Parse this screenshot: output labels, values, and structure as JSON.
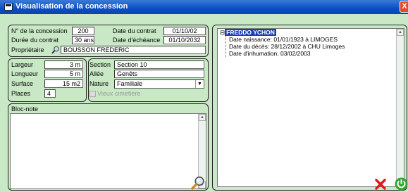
{
  "window": {
    "title": "Visualisation de la concession",
    "close_symbol": "X"
  },
  "concession": {
    "numero_label": "N° de la concession",
    "numero_value": "200",
    "duree_label": "Durée du contrat",
    "duree_value": "30 ans",
    "date_contrat_label": "Date du contrat",
    "date_contrat_value": "01/10/02",
    "date_echeance_label": "Date d'échéance",
    "date_echeance_value": "01/10/2032",
    "proprietaire_label": "Propriétaire",
    "proprietaire_value": "BOUSSON FREDERIC"
  },
  "dimensions": {
    "largeur_label": "Largeur",
    "largeur_value": "3 m",
    "longueur_label": "Longueur",
    "longueur_value": "5 m",
    "surface_label": "Surface",
    "surface_value": "15 m2",
    "places_label": "Places",
    "places_value": "4"
  },
  "location": {
    "section_label": "Section",
    "section_value": "Section 10",
    "allee_label": "Allée",
    "allee_value": "Genêts",
    "nature_label": "Nature",
    "nature_value": "Familiale",
    "vieux_cimetiere_label": "Vieux cimetière"
  },
  "bloc_note": {
    "label": "Bloc-note",
    "text": ""
  },
  "tree": {
    "expander": "⊟",
    "root": "FREDDO YCHON",
    "children": [
      "Date naissance: 01/01/1923 à LIMOGES",
      "Date du décès: 28/12/2002 à CHU Limoges",
      "Date d'inhumation: 03/02/2003"
    ]
  },
  "colors": {
    "background": "#c9e9c6",
    "titlebar": "#0a4fc8",
    "selection": "#1a3fb5",
    "cancel": "#e01a1a",
    "validate": "#2fa82f"
  },
  "icons": [
    "magnifier-icon",
    "cancel-icon",
    "power-icon",
    "dropdown-arrow-icon",
    "scroll-arrow-icon"
  ]
}
